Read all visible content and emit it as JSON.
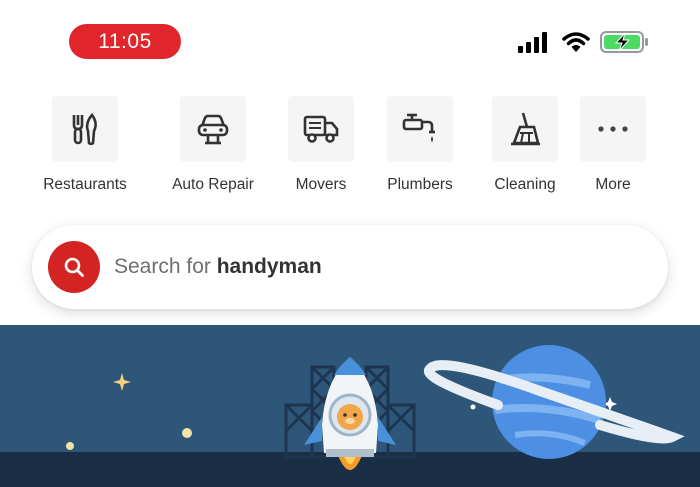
{
  "status_bar": {
    "time": "11:05"
  },
  "categories": [
    {
      "label": "Restaurants",
      "icon": "fork-knife-icon"
    },
    {
      "label": "Auto Repair",
      "icon": "car-lift-icon"
    },
    {
      "label": "Movers",
      "icon": "truck-icon"
    },
    {
      "label": "Plumbers",
      "icon": "faucet-icon"
    },
    {
      "label": "Cleaning",
      "icon": "broom-icon"
    },
    {
      "label": "More",
      "icon": "more-dots-icon"
    }
  ],
  "search": {
    "prefix": "Search for ",
    "term": "handyman"
  },
  "colors": {
    "accent": "#d32323",
    "time_pill": "#e0252b",
    "banner_sky": "#2d5678",
    "banner_ground": "#1a2e45",
    "battery": "#4cd964"
  }
}
